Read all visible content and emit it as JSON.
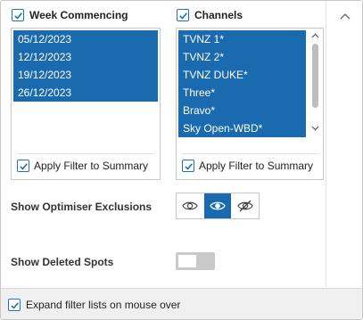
{
  "week_commencing": {
    "header_label": "Week Commencing",
    "checked": true,
    "items": [
      "05/12/2023",
      "12/12/2023",
      "19/12/2023",
      "26/12/2023"
    ],
    "apply_filter_label": "Apply Filter to Summary",
    "apply_filter_checked": true
  },
  "channels": {
    "header_label": "Channels",
    "checked": true,
    "items": [
      "TVNZ 1*",
      "TVNZ 2*",
      "TVNZ DUKE*",
      "Three*",
      "Bravo*",
      "Sky Open-WBD*"
    ],
    "apply_filter_label": "Apply Filter to Summary",
    "apply_filter_checked": true
  },
  "optimiser_exclusions": {
    "label": "Show Optimiser Exclusions",
    "options": [
      "eye-icon",
      "eye-filled-icon",
      "eye-off-icon"
    ],
    "selected_index": 1
  },
  "deleted_spots": {
    "label": "Show Deleted Spots",
    "enabled": false
  },
  "footer": {
    "expand_label": "Expand filter lists on mouse over",
    "checked": true
  },
  "colors": {
    "accent": "#1a6ab0",
    "checkbox_border": "#1e72bd"
  }
}
